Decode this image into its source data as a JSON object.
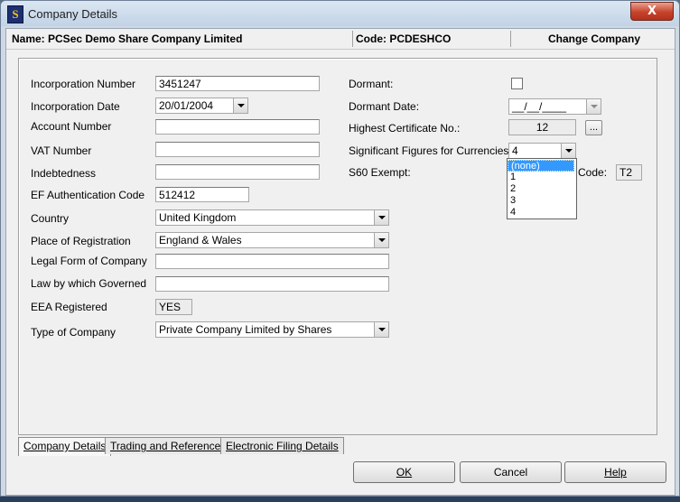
{
  "window": {
    "title": "Company Details",
    "close_glyph": "X"
  },
  "info_bar": {
    "name": "Name: PCSec Demo Share Company Limited",
    "code": "Code: PCDESHCO",
    "change_company": "Change Company"
  },
  "left_fields": {
    "incorporation_number": {
      "label": "Incorporation Number",
      "value": "3451247"
    },
    "incorporation_date": {
      "label": "Incorporation Date",
      "value": "20/01/2004"
    },
    "account_number": {
      "label": "Account Number",
      "value": ""
    },
    "vat_number": {
      "label": "VAT Number",
      "value": ""
    },
    "indebtedness": {
      "label": "Indebtedness",
      "value": ""
    },
    "ef_auth_code": {
      "label": "EF Authentication Code",
      "value": "512412"
    },
    "country": {
      "label": "Country",
      "value": "United Kingdom"
    },
    "place_of_registration": {
      "label": "Place of Registration",
      "value": "England & Wales"
    },
    "legal_form": {
      "label": "Legal Form of Company",
      "value": ""
    },
    "law_governed": {
      "label": "Law by which Governed",
      "value": ""
    },
    "eea_registered": {
      "label": "EEA Registered",
      "value": "YES"
    },
    "type_of_company": {
      "label": "Type of Company",
      "value": "Private Company Limited by Shares"
    }
  },
  "right_fields": {
    "dormant": {
      "label": "Dormant:",
      "checked": false
    },
    "dormant_date": {
      "label": "Dormant Date:",
      "value": "__/__/____"
    },
    "highest_certificate": {
      "label": "Highest Certificate No.:",
      "value": "12",
      "button": "..."
    },
    "sig_figures": {
      "label": "Significant Figures for Currencies:",
      "value": "4"
    },
    "s60_exempt": {
      "label": "S60 Exempt:"
    },
    "code": {
      "label": "Code:",
      "value": "T2"
    }
  },
  "sig_figures_options": [
    "(none)",
    "1",
    "2",
    "3",
    "4"
  ],
  "tabs": [
    {
      "label": "Company Details",
      "active": true
    },
    {
      "label": "Trading and References",
      "active": false
    },
    {
      "label": "Electronic Filing Details",
      "active": false
    }
  ],
  "buttons": {
    "ok": "OK",
    "cancel": "Cancel",
    "help": "Help"
  }
}
